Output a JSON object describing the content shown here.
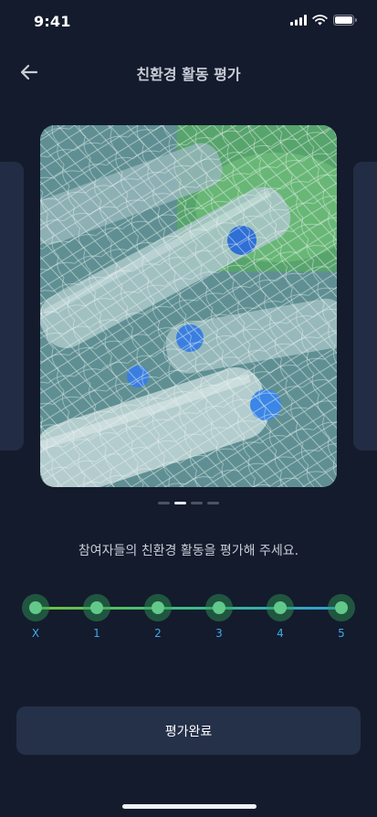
{
  "status": {
    "time": "9:41",
    "icons": [
      "signal-icon",
      "wifi-icon",
      "battery-icon"
    ]
  },
  "header": {
    "title": "친환경 활동 평가",
    "back_icon": "arrow-left-icon"
  },
  "carousel": {
    "image_subject": "plastic bottles under fishing net",
    "page_count": 4,
    "active_index": 1
  },
  "prompt": "참여자들의 친환경 활동을 평가해 주세요.",
  "rating": {
    "steps": [
      "X",
      "1",
      "2",
      "3",
      "4",
      "5"
    ],
    "colors": {
      "start": "#6fc23c",
      "end": "#2d9ed6",
      "label": "#3fa9e6"
    }
  },
  "submit_label": "평가완료"
}
